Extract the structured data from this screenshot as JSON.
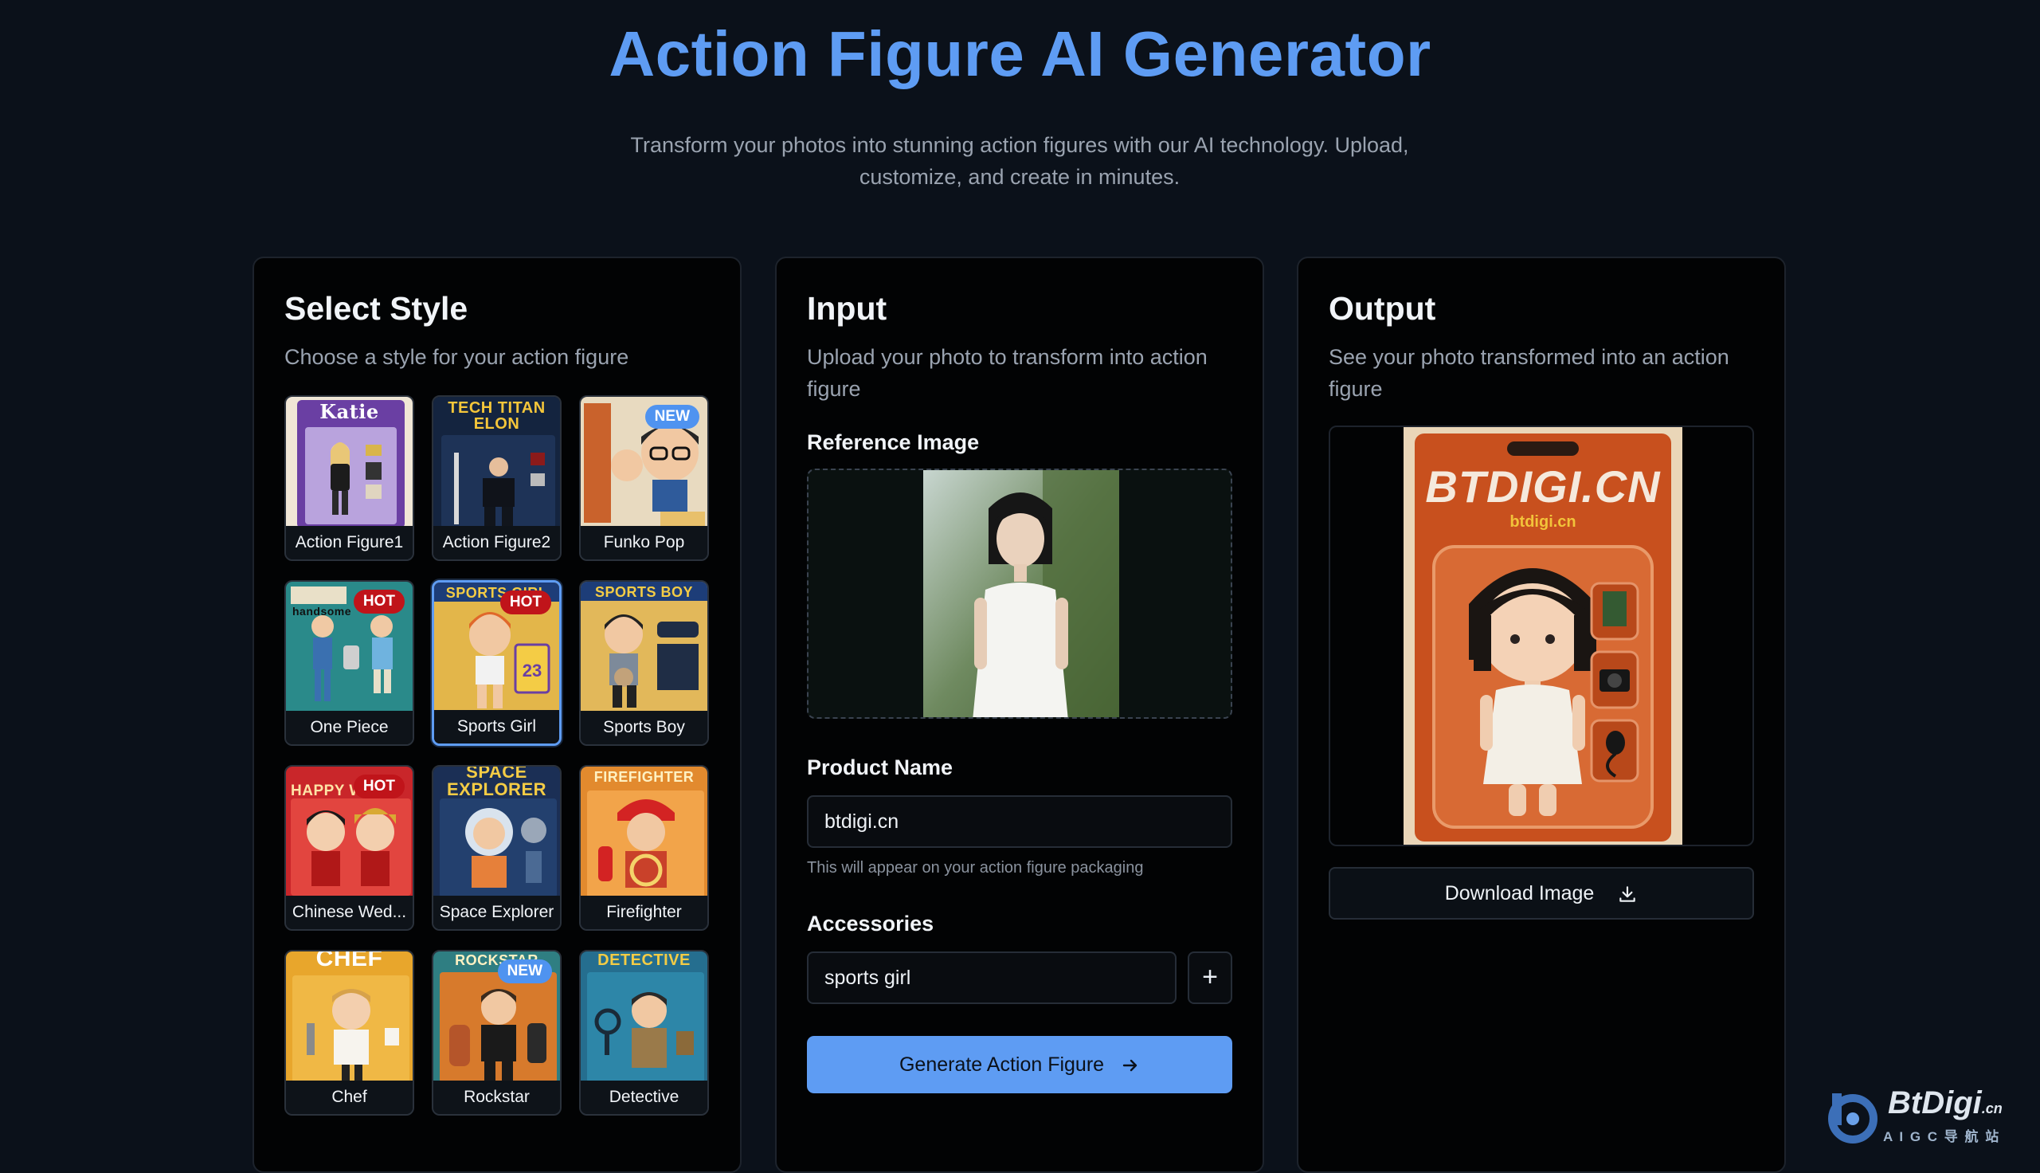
{
  "header": {
    "title": "Action Figure AI Generator",
    "subtitle": "Transform your photos into stunning action figures with our AI technology. Upload, customize, and create in minutes."
  },
  "style_panel": {
    "title": "Select Style",
    "description": "Choose a style for your action figure",
    "selected": "Sports Girl",
    "styles": [
      {
        "label": "Action Figure1",
        "badge": "",
        "banner": "Katie"
      },
      {
        "label": "Action Figure2",
        "badge": "",
        "banner": "TECH TITAN ELON"
      },
      {
        "label": "Funko Pop",
        "badge": "NEW",
        "banner": ""
      },
      {
        "label": "One Piece",
        "badge": "HOT",
        "banner": "handsome"
      },
      {
        "label": "Sports Girl",
        "badge": "HOT",
        "banner": "SPORTS GIRL"
      },
      {
        "label": "Sports Boy",
        "badge": "",
        "banner": "SPORTS BOY"
      },
      {
        "label": "Chinese Wed...",
        "badge": "HOT",
        "banner": "HAPPY W"
      },
      {
        "label": "Space Explorer",
        "badge": "",
        "banner": "SPACE EXPLORER"
      },
      {
        "label": "Firefighter",
        "badge": "",
        "banner": "FIREFIGHTER"
      },
      {
        "label": "Chef",
        "badge": "",
        "banner": "CHEF"
      },
      {
        "label": "Rockstar",
        "badge": "NEW",
        "banner": "ROCKSTAR"
      },
      {
        "label": "Detective",
        "badge": "",
        "banner": "DETECTIVE"
      }
    ]
  },
  "input_panel": {
    "title": "Input",
    "description": "Upload your photo to transform into action figure",
    "reference_label": "Reference Image",
    "product_name_label": "Product Name",
    "product_name_value": "btdigi.cn",
    "product_name_hint": "This will appear on your action figure packaging",
    "accessories_label": "Accessories",
    "accessories_value": "sports girl",
    "add_button": "+",
    "generate_button": "Generate Action Figure"
  },
  "output_panel": {
    "title": "Output",
    "description": "See your photo transformed into an action figure",
    "package_brand": "BTDIGI.CN",
    "package_sub": "btdigi.cn",
    "download_button": "Download Image"
  },
  "watermark": {
    "brand": "BtDigi",
    "suffix": ".cn",
    "tagline": "A I G C 导 航 站"
  },
  "colors": {
    "accent": "#5e9cf3",
    "hot": "#c0141a",
    "new": "#4f93f0",
    "background": "#0b111a"
  }
}
